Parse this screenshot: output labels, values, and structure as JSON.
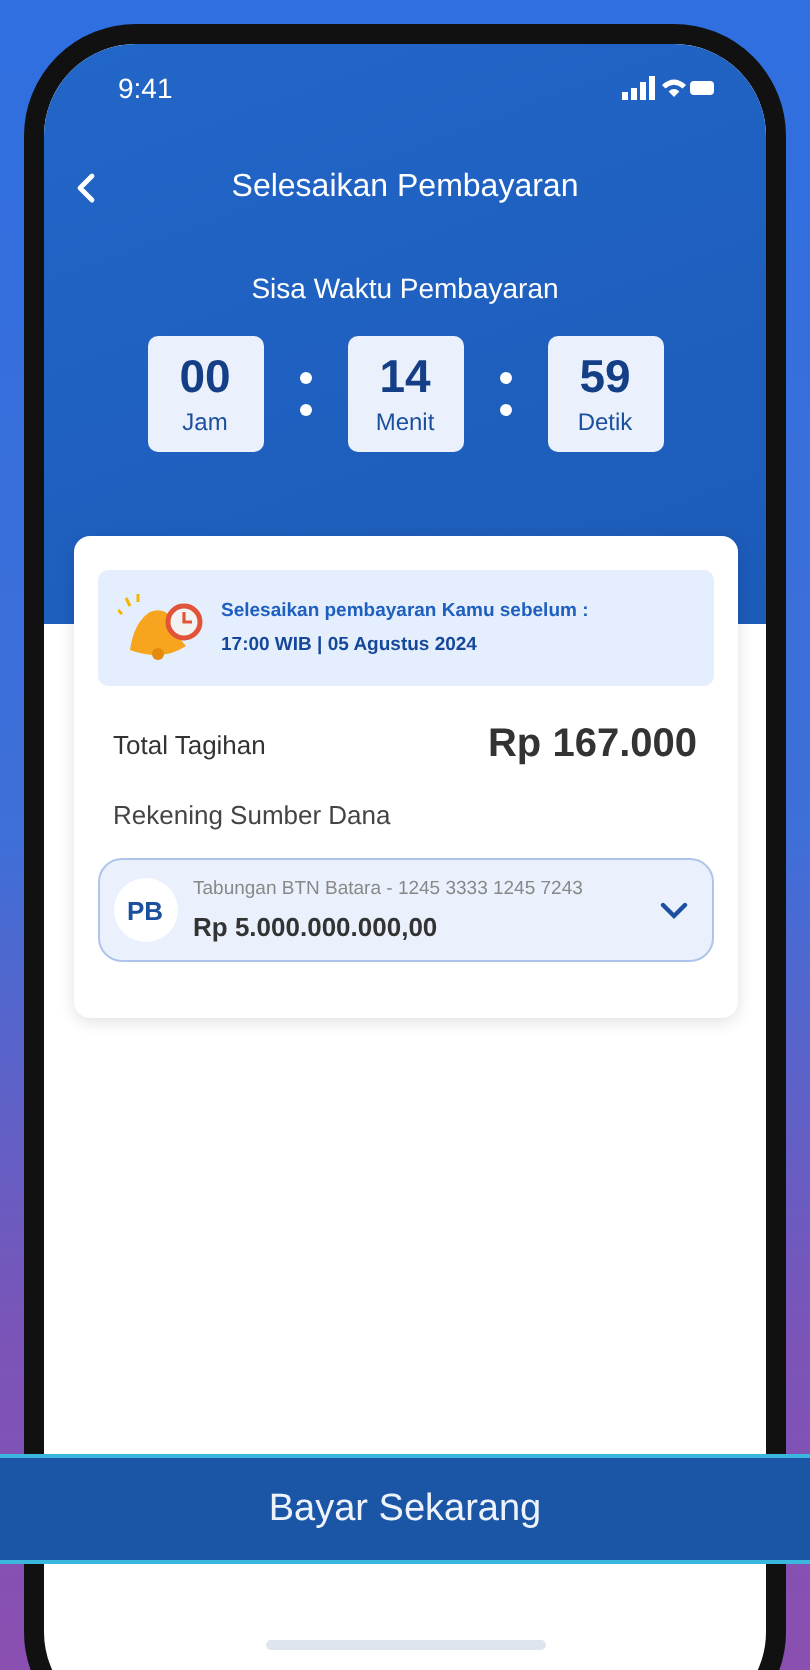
{
  "status_bar": {
    "time": "9:41"
  },
  "header": {
    "title": "Selesaikan Pembayaran"
  },
  "countdown": {
    "title": "Sisa Waktu Pembayaran",
    "units": [
      {
        "value": "00",
        "label": "Jam"
      },
      {
        "value": "14",
        "label": "Menit"
      },
      {
        "value": "59",
        "label": "Detik"
      }
    ]
  },
  "deadline": {
    "line_1": "Selesaikan pembayaran Kamu sebelum :",
    "line_2": "17:00 WIB | 05 Agustus 2024"
  },
  "total": {
    "label": "Total Tagihan",
    "amount": "Rp 167.000"
  },
  "source": {
    "label": "Rekening Sumber Dana",
    "account": {
      "initials": "PB",
      "name": "Tabungan BTN Batara - 1245 3333 1245 7243",
      "balance": "Rp 5.000.000.000,00"
    }
  },
  "pay_button": {
    "label": "Bayar Sekarang"
  }
}
